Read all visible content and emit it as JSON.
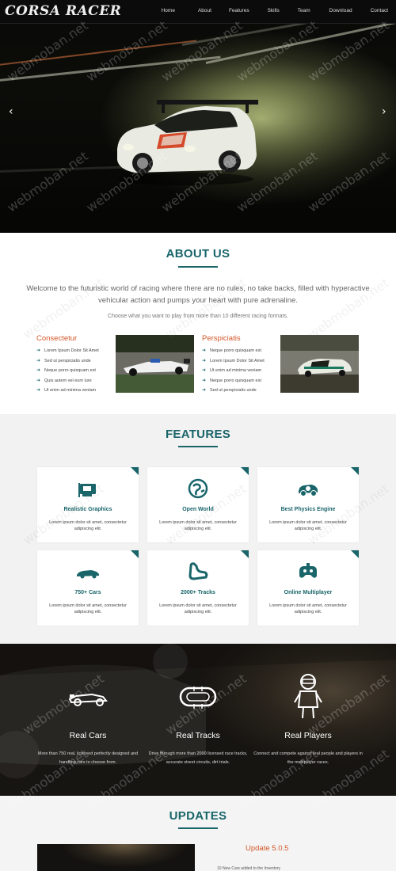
{
  "brand": {
    "logo": "CORSA RACER"
  },
  "nav": {
    "items": [
      "Home",
      "About",
      "Features",
      "Skills",
      "Team",
      "Download",
      "Contact"
    ]
  },
  "hero": {
    "prev": "‹",
    "next": "›"
  },
  "about": {
    "title": "ABOUT US",
    "lead": "Welcome to the futuristic world of racing where there are no rules, no take backs, filled with hyperactive vehicular action and pumps your heart with pure adrenaline.",
    "sub": "Choose what you want to play from more than 10 different racing formats.",
    "col1": {
      "heading": "Consectetur",
      "items": [
        "Lorem Ipsum Dolor Sit Amet",
        "Sed ut perspiciatis unde",
        "Neque porro quisquam est",
        "Quis autem vel eum iure",
        "Ut enim ad minima veniam"
      ]
    },
    "col2": {
      "heading": "Perspiciatis",
      "items": [
        "Neque porro quisquam est",
        "Lorem Ipsum Dolor Sit Amet",
        "Ut enim ad minima veniam",
        "Neque porro quisquam est",
        "Sed ut perspiciatis unde"
      ]
    }
  },
  "features": {
    "title": "FEATURES",
    "cards": [
      {
        "icon": "graphics-card-icon",
        "title": "Realistic Graphics",
        "desc": "Lorem ipsum dolor sit amet, consectetur adipiscing elit."
      },
      {
        "icon": "globe-icon",
        "title": "Open World",
        "desc": "Lorem ipsum dolor sit amet, consectetur adipiscing elit."
      },
      {
        "icon": "physics-car-icon",
        "title": "Best Physics Engine",
        "desc": "Lorem ipsum dolor sit amet, consectetur adipiscing elit."
      },
      {
        "icon": "race-car-icon",
        "title": "750+ Cars",
        "desc": "Lorem ipsum dolor sit amet, consectetur adipiscing elit."
      },
      {
        "icon": "track-icon",
        "title": "2000+ Tracks",
        "desc": "Lorem ipsum dolor sit amet, consectetur adipiscing elit."
      },
      {
        "icon": "gamepad-icon",
        "title": "Online Multiplayer",
        "desc": "Lorem ipsum dolor sit amet, consectetur adipiscing elit."
      }
    ]
  },
  "real": [
    {
      "icon": "f1-car-icon",
      "title": "Real Cars",
      "desc": "More than 750 real, licensed perfectly designed and handling cars to choose from."
    },
    {
      "icon": "circuit-icon",
      "title": "Real Tracks",
      "desc": "Drive through more than 2000 licensed race tracks, accurate street circuits, dirt trials."
    },
    {
      "icon": "driver-icon",
      "title": "Real Players",
      "desc": "Connect and compete against real people and players in the multiplayer races."
    }
  ],
  "updates": {
    "title": "UPDATES",
    "item_title": "Update 5.0.5",
    "item_line": "10 New Cars added to the Inventory"
  },
  "watermark": "webmoban.net",
  "colors": {
    "accent": "#19656a",
    "orange": "#d3572a"
  }
}
